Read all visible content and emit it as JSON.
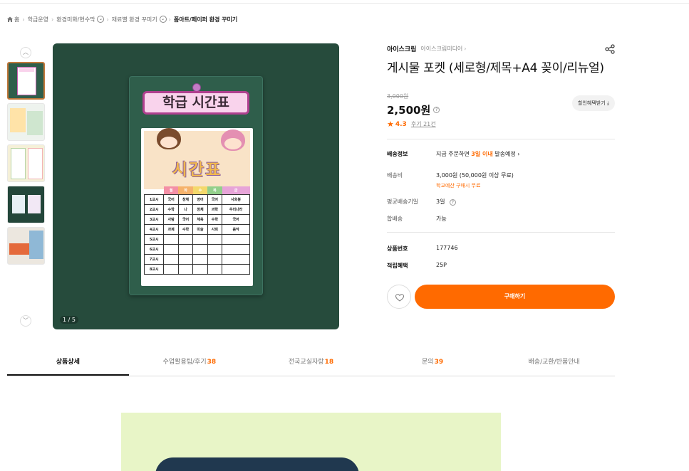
{
  "breadcrumb": {
    "items": [
      "홈",
      "학급운영",
      "환경미화/현수막",
      "재료별 환경 꾸미기",
      "폼아트/페이퍼 환경 꾸미기"
    ]
  },
  "gallery": {
    "counter": "1 / 5",
    "thumb_count": 5,
    "board_title": "학급 시간표",
    "paper_word": "시간표",
    "days": [
      "월",
      "화",
      "수",
      "목",
      "금"
    ],
    "periods": [
      "1교시",
      "2교시",
      "3교시",
      "4교시",
      "5교시",
      "6교시",
      "7교시",
      "8교시"
    ],
    "cells": [
      [
        "국어",
        "창체",
        "영어",
        "국어",
        "사회봉"
      ],
      [
        "수학",
        "나",
        "창체",
        "과학",
        "우리나라"
      ],
      [
        "사탐",
        "국어",
        "체육",
        "수학",
        "국어"
      ],
      [
        "과제",
        "수학",
        "미술",
        "사회",
        "음악"
      ]
    ]
  },
  "product": {
    "brand": "아이스크림",
    "brand_sub": "아이스크림미디어",
    "title": "게시물 포켓 (세로형/제목+A4 꽂이/리뉴얼)",
    "original_price": "3,000원",
    "price": "2,500원",
    "coupon_label": "할인혜택받기",
    "rating": "4.3",
    "review_link": "후기 21건"
  },
  "specs": {
    "shipping_info_label": "배송정보",
    "shipping_info_prefix": "지금 주문하면",
    "shipping_info_accent": "3일 이내",
    "shipping_info_suffix": "발송예정",
    "shipping_fee_label": "배송비",
    "shipping_fee_value": "3,000원 (50,000원 이상 무료)",
    "shipping_fee_note": "학교예산 구매시 무료",
    "avg_days_label": "평균배송기일",
    "avg_days_value": "3일",
    "bundle_label": "합배송",
    "bundle_value": "가능",
    "product_no_label": "상품번호",
    "product_no_value": "177746",
    "points_label": "적립혜택",
    "points_value": "25P"
  },
  "actions": {
    "buy_label": "구매하기"
  },
  "tabs": [
    {
      "label": "상품상세",
      "count": ""
    },
    {
      "label": "수업활용팁/후기",
      "count": "38"
    },
    {
      "label": "전국교실자랑",
      "count": "18"
    },
    {
      "label": "문의",
      "count": "39"
    },
    {
      "label": "배송/교환/반품안내",
      "count": ""
    }
  ],
  "colors": {
    "accent": "#ff6a00",
    "image_bg": "#264b3c",
    "banner_bg": "#e8f5c7"
  }
}
